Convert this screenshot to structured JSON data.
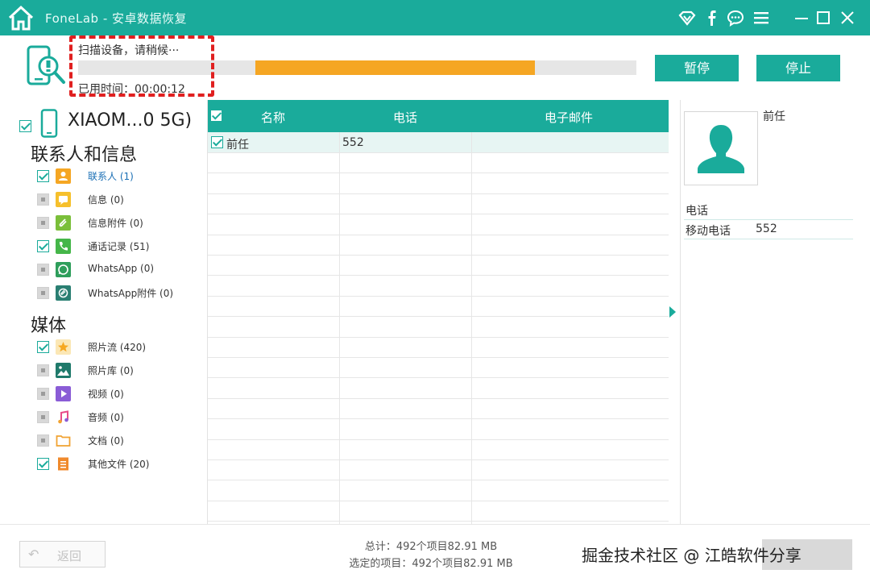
{
  "window": {
    "app_title": "FoneLab - 安卓数据恢复",
    "accent": "#1aab9b",
    "icons": [
      "home-icon",
      "wifi-icon",
      "facebook-icon",
      "chat-icon",
      "menu-icon",
      "minimize-icon",
      "maximize-icon",
      "close-icon"
    ]
  },
  "scan": {
    "status": "扫描设备，请稍候···",
    "elapsed": "已用时间：00:00:12",
    "progress_start_fraction": 0.32,
    "progress_fraction": 0.5,
    "progress_color": "#f5a623",
    "pause_label": "暂停",
    "stop_label": "停止"
  },
  "device": {
    "name": "XIAOM...0 5G)"
  },
  "sidebar": {
    "sections": [
      {
        "title": "联系人和信息",
        "items": [
          {
            "label": "联系人 (1)",
            "checked": true,
            "icon": "contacts-icon",
            "color": "#f5a623",
            "active": true
          },
          {
            "label": "信息 (0)",
            "checked": false,
            "icon": "message-icon",
            "color": "#f6c02c"
          },
          {
            "label": "信息附件 (0)",
            "checked": false,
            "icon": "attachment-icon",
            "color": "#7bbf3a"
          },
          {
            "label": "通话记录 (51)",
            "checked": true,
            "icon": "phone-icon",
            "color": "#45b649"
          },
          {
            "label": "WhatsApp (0)",
            "checked": false,
            "icon": "whatsapp-icon",
            "color": "#2e9e5b"
          },
          {
            "label": "WhatsApp附件 (0)",
            "checked": false,
            "icon": "whatsapp-attachment-icon",
            "color": "#2a7f72"
          }
        ]
      },
      {
        "title": "媒体",
        "items": [
          {
            "label": "照片流 (420)",
            "checked": true,
            "icon": "photostream-icon",
            "color": "#f6a821"
          },
          {
            "label": "照片库 (0)",
            "checked": false,
            "icon": "picture-library-icon",
            "color": "#1f7a6b"
          },
          {
            "label": "视频 (0)",
            "checked": false,
            "icon": "video-icon",
            "color": "#8a5cd6"
          },
          {
            "label": "音频 (0)",
            "checked": false,
            "icon": "audio-icon",
            "color": "#e84c8b"
          },
          {
            "label": "文档 (0)",
            "checked": false,
            "icon": "document-icon",
            "color": "#f1a332"
          },
          {
            "label": "其他文件 (20)",
            "checked": true,
            "icon": "other-files-icon",
            "color": "#f08a2c"
          }
        ]
      }
    ]
  },
  "table": {
    "columns": [
      "名称",
      "电话",
      "电子邮件"
    ],
    "rows": [
      {
        "name": "前任",
        "phone": "552",
        "email": "",
        "checked": true
      }
    ]
  },
  "detail": {
    "name": "前任",
    "section": "电话",
    "key": "移动电话",
    "value": "552"
  },
  "footer": {
    "back_label": "返回",
    "total": "总计：492个项目82.91 MB",
    "selected": "选定的项目：492个项目82.91 MB",
    "watermark": "掘金技术社区 @ 江皓软件分享"
  }
}
